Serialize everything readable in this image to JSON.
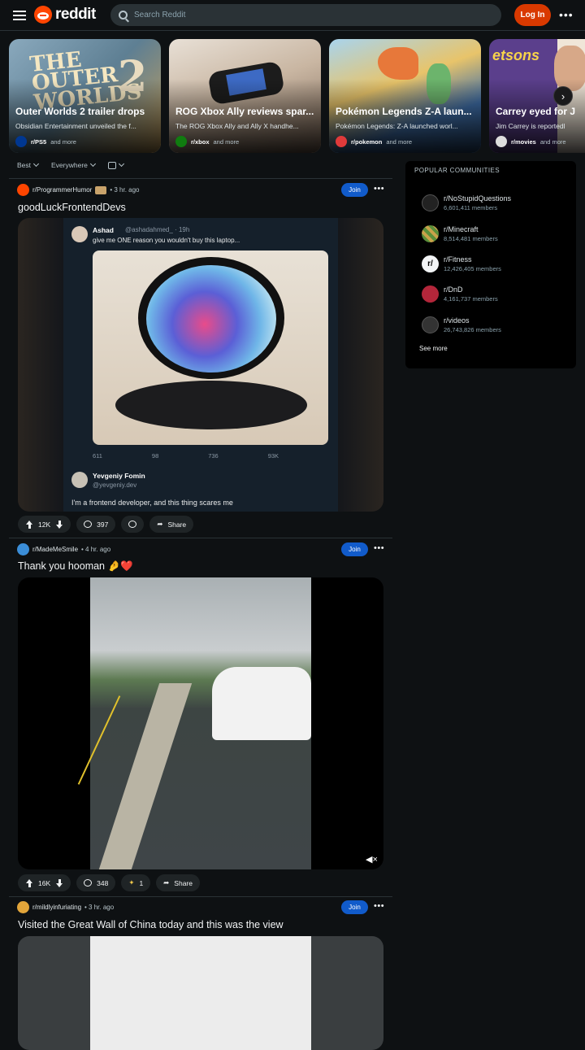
{
  "header": {
    "logo_text": "reddit",
    "search_placeholder": "Search Reddit",
    "login_label": "Log In",
    "more_label": "•••"
  },
  "carousel": [
    {
      "title": "Outer Worlds 2 trailer drops",
      "desc": "Obsidian Entertainment unveiled the f...",
      "sub": "r/PS5",
      "more": "and more",
      "bg": "#6f8fa6"
    },
    {
      "title": "ROG Xbox Ally reviews spar...",
      "desc": "The ROG Xbox Ally and Ally X handhe...",
      "sub": "r/xbox",
      "more": "and more",
      "bg": "#b49c86"
    },
    {
      "title": "Pokémon Legends Z-A laun...",
      "desc": "Pokémon Legends: Z-A launched worl...",
      "sub": "r/pokemon",
      "more": "and more",
      "bg": "#4d7fb0"
    },
    {
      "title": "Carrey eyed for J",
      "desc": "Jim Carrey is reportedl",
      "sub": "r/movies",
      "more": "and more",
      "bg": "#6a4f8a"
    }
  ],
  "sort": {
    "best": "Best",
    "where": "Everywhere"
  },
  "posts": [
    {
      "sub": "r/ProgrammerHumor",
      "time": "• 3 hr. ago",
      "join": "Join",
      "title": "goodLuckFrontendDevs",
      "tweet": {
        "name": "Ashad",
        "handle": "@ashadahmed_ · 19h",
        "text": "give me ONE reason you wouldn't buy this laptop...",
        "stats": [
          "611",
          "98",
          "736",
          "93K"
        ],
        "reply_name": "Yevgeniy Fomin",
        "reply_handle": "@yevgeniy.dev",
        "reply_text": "I'm a frontend developer, and this thing scares me"
      },
      "votes": "12K",
      "comments": "397",
      "share": "Share"
    },
    {
      "sub": "r/MadeMeSmile",
      "time": "• 4 hr. ago",
      "join": "Join",
      "title": "Thank you hooman �along❤️",
      "votes": "16K",
      "comments": "348",
      "awards": "1",
      "share": "Share"
    },
    {
      "sub": "r/mildlyinfuriating",
      "time": "• 3 hr. ago",
      "join": "Join",
      "title": "Visited the Great Wall of China today and this was the view"
    }
  ],
  "popular": {
    "heading": "POPULAR COMMUNITIES",
    "items": [
      {
        "name": "r/NoStupidQuestions",
        "members": "6,601,411 members",
        "color": "#222"
      },
      {
        "name": "r/Minecraft",
        "members": "8,514,481 members",
        "color": "#c9a24a"
      },
      {
        "name": "r/Fitness",
        "members": "12,426,405 members",
        "color": "#f2f4f5"
      },
      {
        "name": "r/DnD",
        "members": "4,161,737 members",
        "color": "#b3263a"
      },
      {
        "name": "r/videos",
        "members": "26,743,826 members",
        "color": "#333"
      }
    ],
    "see_more": "See more"
  }
}
